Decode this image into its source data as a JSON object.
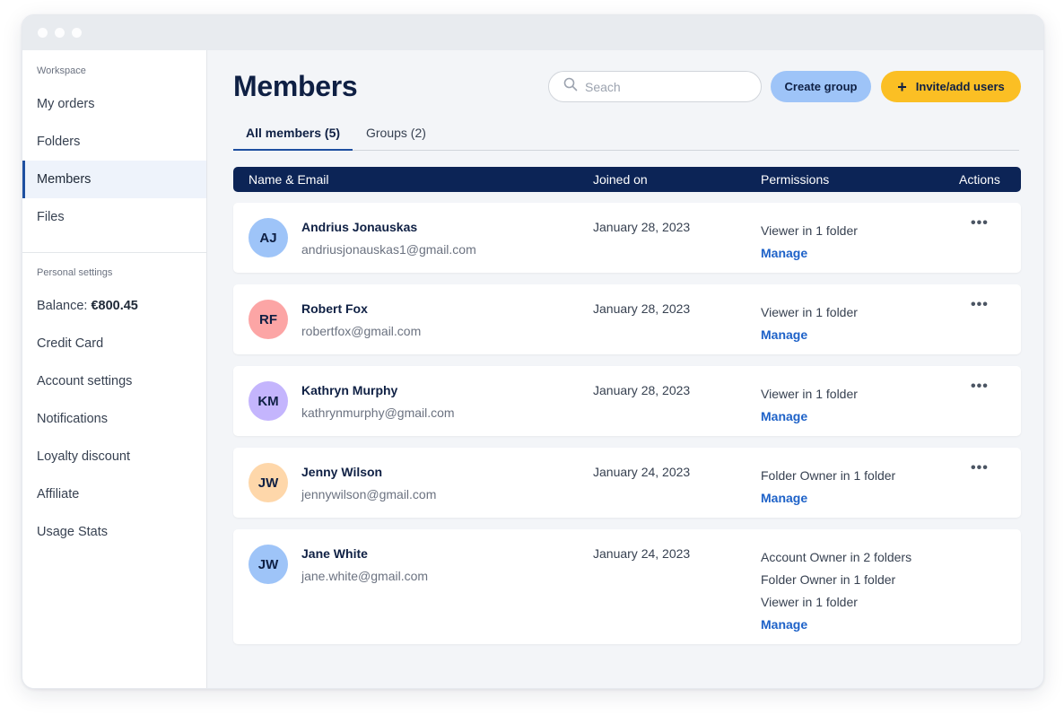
{
  "sidebar": {
    "workspace_label": "Workspace",
    "workspace_items": [
      {
        "label": "My orders"
      },
      {
        "label": "Folders"
      },
      {
        "label": "Members"
      },
      {
        "label": "Files"
      }
    ],
    "personal_label": "Personal settings",
    "balance_label": "Balance:",
    "balance_value": "€800.45",
    "personal_items": [
      {
        "label": "Credit Card"
      },
      {
        "label": "Account settings"
      },
      {
        "label": "Notifications"
      },
      {
        "label": "Loyalty discount"
      },
      {
        "label": "Affiliate"
      },
      {
        "label": "Usage Stats"
      }
    ]
  },
  "header": {
    "title": "Members",
    "search_placeholder": "Seach",
    "create_group_label": "Create group",
    "invite_plus": "+",
    "invite_label": "Invite/add users"
  },
  "tabs": [
    {
      "label": "All members (5)"
    },
    {
      "label": "Groups (2)"
    }
  ],
  "table": {
    "columns": [
      "Name & Email",
      "Joined on",
      "Permissions",
      "Actions"
    ],
    "manage_label": "Manage",
    "actions_label": "•••",
    "rows": [
      {
        "initials": "AJ",
        "avatar_color": "#9ec4f8",
        "name": "Andrius Jonauskas",
        "email": "andriusjonauskas1@gmail.com",
        "joined": "January 28, 2023",
        "permissions": [
          "Viewer in 1 folder"
        ]
      },
      {
        "initials": "RF",
        "avatar_color": "#fca5a5",
        "name": "Robert Fox",
        "email": "robertfox@gmail.com",
        "joined": "January 28, 2023",
        "permissions": [
          "Viewer in 1 folder"
        ]
      },
      {
        "initials": "KM",
        "avatar_color": "#c4b5fd",
        "name": "Kathryn Murphy",
        "email": "kathrynmurphy@gmail.com",
        "joined": "January 28, 2023",
        "permissions": [
          "Viewer in 1 folder"
        ]
      },
      {
        "initials": "JW",
        "avatar_color": "#fed7aa",
        "name": "Jenny Wilson",
        "email": "jennywilson@gmail.com",
        "joined": "January 24, 2023",
        "permissions": [
          "Folder Owner in 1 folder"
        ]
      },
      {
        "initials": "JW",
        "avatar_color": "#9ec4f8",
        "name": "Jane White",
        "email": "jane.white@gmail.com",
        "joined": "January 24, 2023",
        "permissions": [
          "Account Owner in 2 folders",
          "Folder Owner in 1 folder",
          "Viewer in 1 folder"
        ]
      }
    ]
  },
  "colors": {
    "accent": "#1e4fa0",
    "header_bg": "#0c2456",
    "invite_button": "#fbbf24",
    "create_button": "#9ec4f8",
    "link": "#1e62c8"
  }
}
